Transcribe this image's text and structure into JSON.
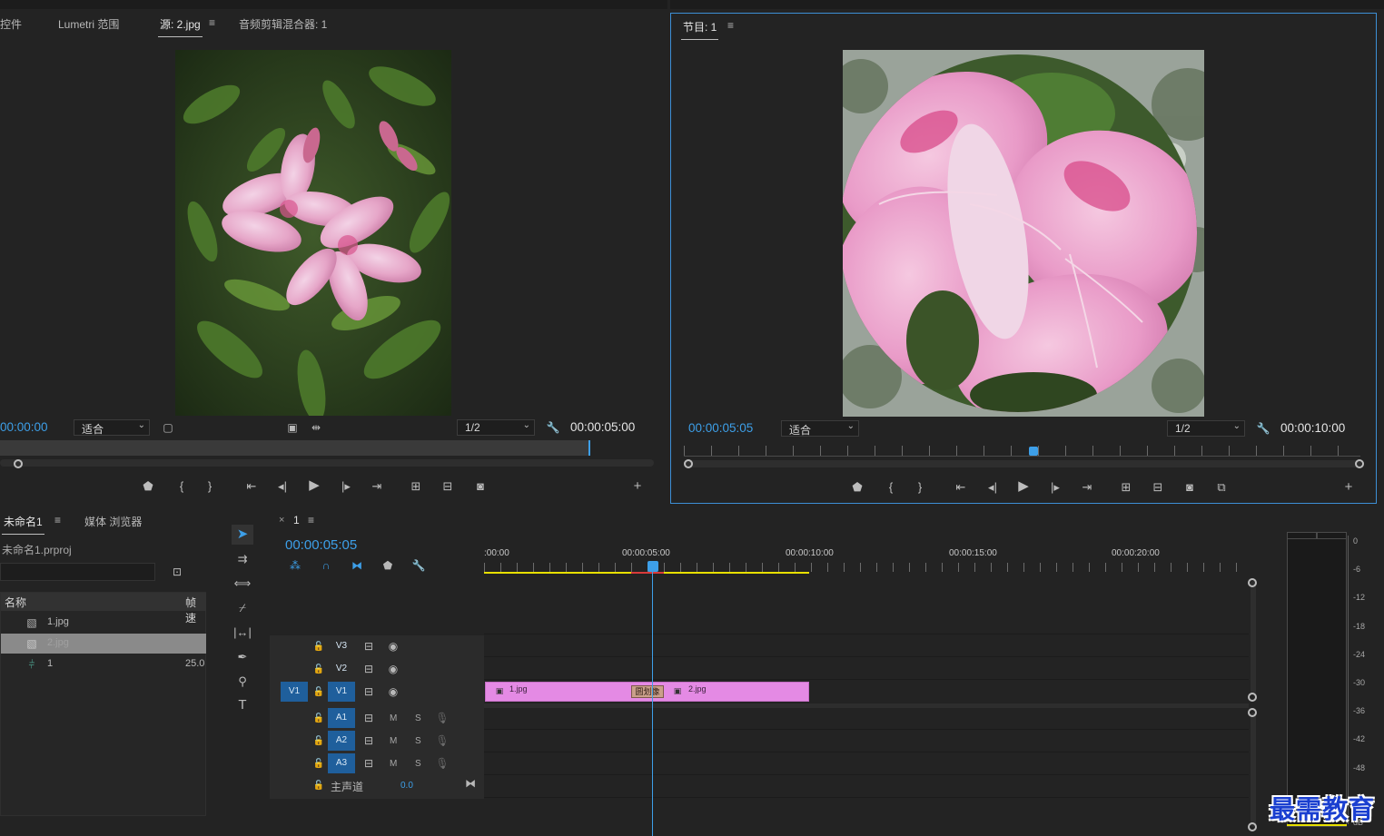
{
  "source_monitor": {
    "tabs": [
      "控件",
      "Lumetri 范围",
      "源: 2.jpg",
      "音频剪辑混合器: 1"
    ],
    "menu_glyph": "≡",
    "timecode_current": "00:00:00",
    "fit_label": "适合",
    "resolution_label": "1/2",
    "timecode_duration": "00:00:05:00"
  },
  "program_monitor": {
    "title": "节目: 1",
    "menu_glyph": "≡",
    "timecode_current": "00:00:05:05",
    "fit_label": "适合",
    "resolution_label": "1/2",
    "timecode_duration": "00:00:10:00"
  },
  "project_panel": {
    "tabs": [
      "未命名1",
      "媒体 浏览器"
    ],
    "menu_glyph": "≡",
    "project_file": "未命名1.prproj",
    "columns": [
      "名称",
      "帧速"
    ],
    "items": [
      {
        "name": "1.jpg",
        "rate": "",
        "icon": "image-file-icon"
      },
      {
        "name": "2.jpg",
        "rate": "",
        "icon": "image-file-icon"
      },
      {
        "name": "1",
        "rate": "25.0",
        "icon": "sequence-icon"
      }
    ]
  },
  "timeline": {
    "close_glyph": "×",
    "sequence_tab": "1",
    "menu_glyph": "≡",
    "timecode": "00:00:05:05",
    "ruler_labels": [
      ":00:00",
      "00:00:05:00",
      "00:00:10:00",
      "00:00:15:00",
      "00:00:20:00"
    ],
    "video_tracks": [
      "V3",
      "V2",
      "V1"
    ],
    "audio_tracks": [
      "A1",
      "A2",
      "A3"
    ],
    "source_patch": "V1",
    "mute_label": "M",
    "solo_label": "S",
    "master_label": "主声道",
    "master_value": "0.0",
    "clips": [
      {
        "name": "1.jpg",
        "track": "V1"
      },
      {
        "name": "2.jpg",
        "track": "V1"
      }
    ],
    "transition_label": "圆划像"
  },
  "audio_meter": {
    "scale": [
      "0",
      "-6",
      "-12",
      "-18",
      "-24",
      "-30",
      "-36",
      "-42",
      "-48",
      "dB"
    ]
  },
  "watermark": "最需教育",
  "colors": {
    "accent_blue": "#3d9fe8",
    "clip_pink": "#e48ae4",
    "track_blue": "#1f5f9c",
    "work_area_yellow": "#e8e000"
  }
}
